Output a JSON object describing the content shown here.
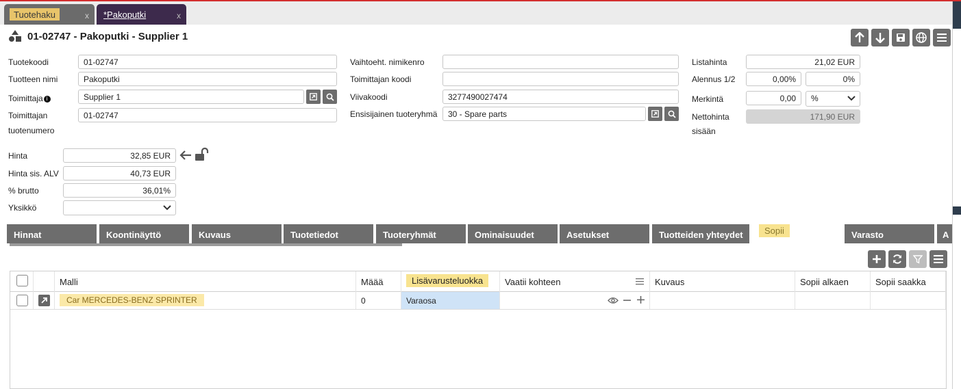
{
  "doc_tabs": [
    {
      "label": "Tuotehaku",
      "close": "x"
    },
    {
      "label": "*Pakoputki",
      "close": "x"
    }
  ],
  "header": {
    "title": "01-02747 - Pakoputki - Supplier 1",
    "actions": [
      "arrow-up-icon",
      "arrow-down-icon",
      "save-icon",
      "globe-icon",
      "menu-icon"
    ]
  },
  "form": {
    "tuotekoodi": {
      "label": "Tuotekoodi",
      "value": "01-02747"
    },
    "tuotteen_nimi": {
      "label": "Tuotteen nimi",
      "value": "Pakoputki"
    },
    "toimittaja": {
      "label": "Toimittaja",
      "value": "Supplier 1"
    },
    "toimittajan_tuotenumero": {
      "label1": "Toimittajan",
      "label2": "tuotenumero",
      "value": "01-02747"
    },
    "vaihtoeht_nimikenro": {
      "label": "Vaihtoeht. nimikenro",
      "value": ""
    },
    "toimittajan_koodi": {
      "label": "Toimittajan koodi",
      "value": ""
    },
    "viivakoodi": {
      "label": "Viivakoodi",
      "value": "3277490027474"
    },
    "ensisijainen_tuoteryhma": {
      "label": "Ensisijainen tuoteryhmä",
      "value": "30 - Spare parts"
    },
    "listahinta": {
      "label": "Listahinta",
      "value": "21,02 EUR"
    },
    "alennus": {
      "label": "Alennus 1/2",
      "value1": "0,00%",
      "value2": "0%"
    },
    "merkinta": {
      "label": "Merkintä",
      "value": "0,00",
      "unit": "%"
    },
    "nettohinta": {
      "label1": "Nettohinta",
      "label2": "sisään",
      "value": "171,90 EUR"
    },
    "hinta": {
      "label": "Hinta",
      "value": "32,85 EUR"
    },
    "hinta_alv": {
      "label": "Hinta sis. ALV",
      "value": "40,73 EUR"
    },
    "brutto": {
      "label": "% brutto",
      "value": "36,01%"
    },
    "yksikko": {
      "label": "Yksikkö",
      "value": ""
    }
  },
  "panel_tabs": [
    "Hinnat",
    "Koontinäyttö",
    "Kuvaus",
    "Tuotetiedot",
    "Tuoteryhmät",
    "Ominaisuudet",
    "Asetukset",
    "Tuotteiden yhteydet",
    "Sopii",
    "Varasto",
    "A"
  ],
  "active_tab": "Sopii",
  "grid": {
    "columns": [
      "Malli",
      "Määä",
      "Lisävarusteluokka",
      "Vaatii kohteen",
      "Kuvaus",
      "Sopii alkaen",
      "Sopii saakka"
    ],
    "rows": [
      {
        "malli": "Car MERCEDES-BENZ SPRINTER",
        "maara": "0",
        "luokka": "Varaosa",
        "vaatii": "",
        "kuvaus": "",
        "alkaen": "",
        "saakka": ""
      }
    ]
  }
}
